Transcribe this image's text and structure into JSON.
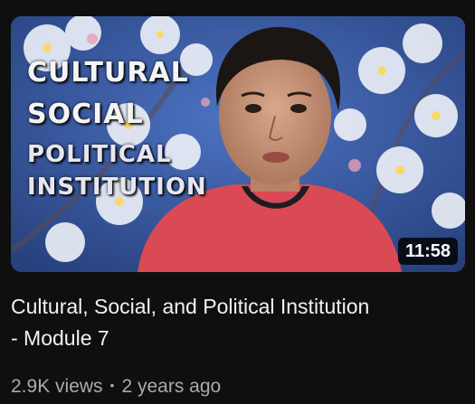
{
  "video": {
    "thumbnail": {
      "overlay_lines": [
        "CULTURAL",
        "SOCIAL",
        "POLITICAL",
        "INSTITUTION"
      ],
      "duration": "11:58",
      "background_color": "#3d5ea6",
      "shirt_color": "#d94a55"
    },
    "title_lines": [
      "Cultural, Social, and Political Institution",
      "- Module 7"
    ],
    "views": "2.9K views",
    "separator": "•",
    "age": "2 years ago"
  }
}
